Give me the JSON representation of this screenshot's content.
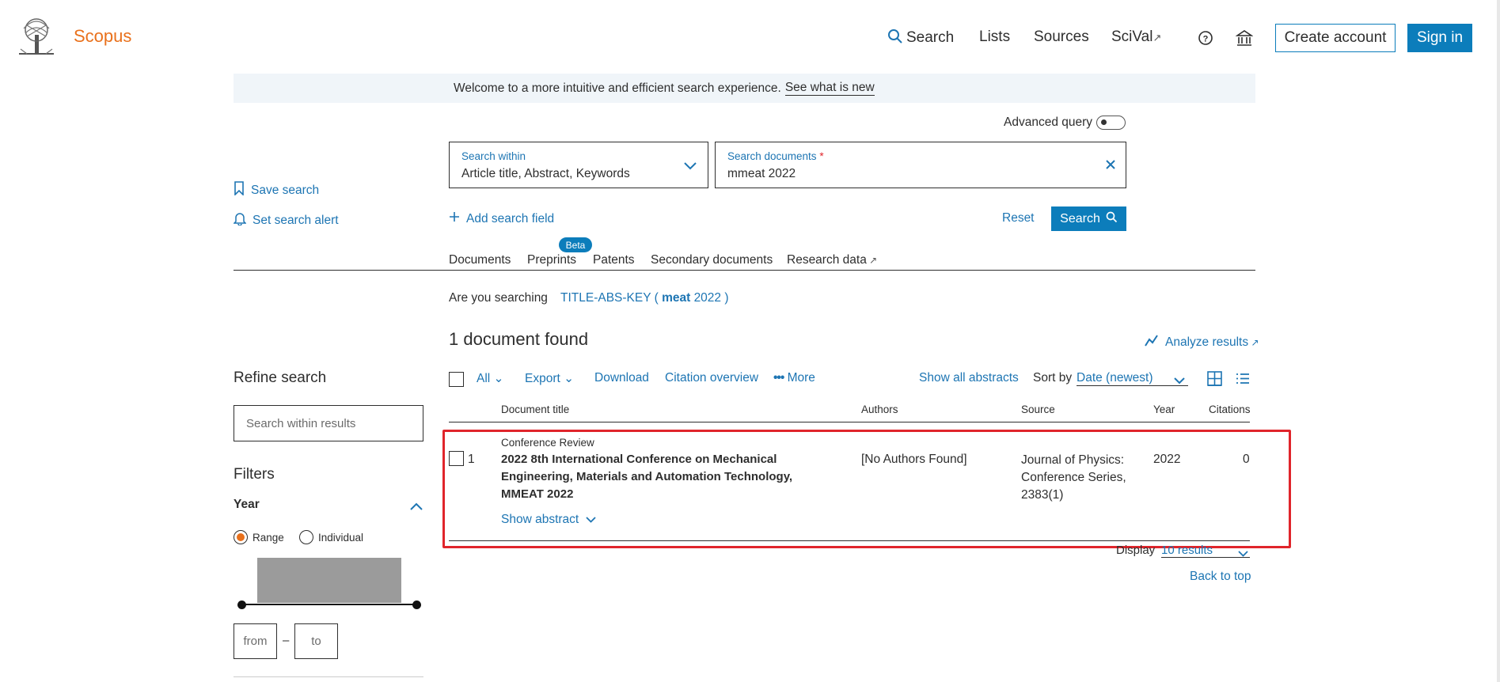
{
  "header": {
    "logo_text": "Scopus",
    "nav": {
      "search": "Search",
      "lists": "Lists",
      "sources": "Sources",
      "scival": "SciVal"
    },
    "create_account": "Create account",
    "sign_in": "Sign in"
  },
  "banner": {
    "message": "Welcome to a more intuitive and efficient search experience.",
    "link": "See what is new"
  },
  "search_form": {
    "advanced_query": "Advanced query",
    "search_within_label": "Search within",
    "search_within_value": "Article title, Abstract, Keywords",
    "search_documents_label": "Search documents",
    "required_mark": "*",
    "search_documents_value": "mmeat 2022",
    "add_search_field": "Add search field",
    "reset": "Reset",
    "search_button": "Search"
  },
  "sidebar": {
    "save_search": "Save search",
    "set_alert": "Set search alert",
    "refine_search": "Refine search",
    "search_within_results_placeholder": "Search within results",
    "filters": "Filters",
    "year": "Year",
    "range": "Range",
    "individual": "Individual",
    "from": "from",
    "dash": "–",
    "to": "to"
  },
  "tabs": {
    "documents": "Documents",
    "preprints": "Preprints",
    "beta": "Beta",
    "patents": "Patents",
    "secondary": "Secondary documents",
    "research_data": "Research data"
  },
  "suggestion": {
    "prefix": "Are you searching",
    "query_start": "TITLE-ABS-KEY (",
    "query_bold": "meat",
    "query_end": "2022 )"
  },
  "results": {
    "count_text": "1 document found",
    "analyze": "Analyze results",
    "toolbar": {
      "all": "All",
      "export": "Export",
      "download": "Download",
      "citation_overview": "Citation overview",
      "more": "More",
      "show_all_abstracts": "Show all abstracts",
      "sort_by": "Sort by",
      "sort_value": "Date (newest)"
    },
    "columns": {
      "title": "Document title",
      "authors": "Authors",
      "source": "Source",
      "year": "Year",
      "citations": "Citations"
    },
    "rows": [
      {
        "index": "1",
        "doc_type": "Conference Review",
        "title_line1": "2022 8th International Conference on Mechanical",
        "title_line2": "Engineering, Materials and Automation Technology,",
        "title_line3": "MMEAT 2022",
        "authors": "[No Authors Found]",
        "source_line1": "Journal of Physics:",
        "source_line2": "Conference Series,",
        "source_line3": "2383(1)",
        "year": "2022",
        "citations": "0",
        "show_abstract": "Show abstract"
      }
    ],
    "display_label": "Display",
    "display_value": "10 results",
    "back_to_top": "Back to top"
  },
  "colors": {
    "brand_orange": "#e9711c",
    "link_blue": "#1d75b3",
    "button_blue": "#0c7dbb",
    "highlight_red": "#e0252b"
  }
}
